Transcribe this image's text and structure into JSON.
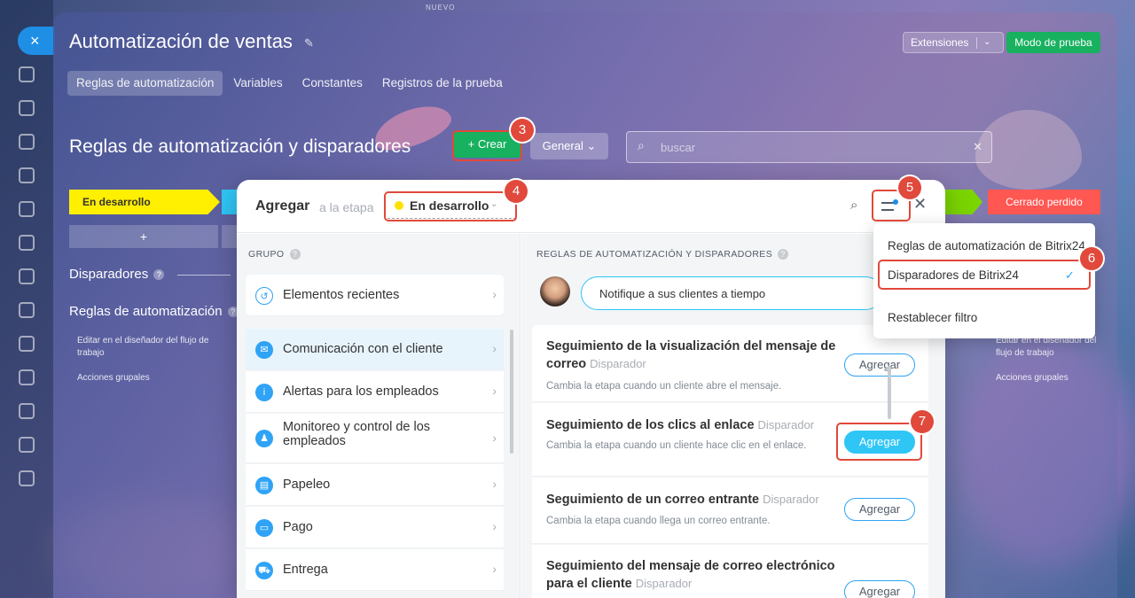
{
  "top_label": "NUEVO",
  "rail": {
    "close_icon": "×"
  },
  "header": {
    "title": "Automatización de ventas",
    "extensions_label": "Extensiones",
    "test_mode_label": "Modo de prueba",
    "tabs": [
      {
        "label": "Reglas de automatización"
      },
      {
        "label": "Variables"
      },
      {
        "label": "Constantes"
      },
      {
        "label": "Registros de la prueba"
      }
    ]
  },
  "toolbar": {
    "heading": "Reglas de automatización y disparadores",
    "create_label": "+ Crear",
    "general_label": "General",
    "search_placeholder": "buscar"
  },
  "stages": {
    "first": "En desarrollo",
    "last": "Cerrado perdido",
    "add_symbol": "+"
  },
  "sections": {
    "triggers": "Disparadores",
    "rules": "Reglas de automatización",
    "edit_link": "Editar en el diseñador del flujo de trabajo",
    "group_actions": "Acciones grupales"
  },
  "popup": {
    "title": "Agregar",
    "subtitle": "a la etapa",
    "stage": "En desarrollo",
    "group_header": "GRUPO",
    "rules_header": "REGLAS DE AUTOMATIZACIÓN Y DISPARADORES",
    "hint": "Notifique a sus clientes a tiempo",
    "groups": [
      {
        "label": "Elementos recientes"
      },
      {
        "label": "Comunicación con el cliente"
      },
      {
        "label": "Alertas para los empleados"
      },
      {
        "label": "Monitoreo y control de los empleados"
      },
      {
        "label": "Papeleo"
      },
      {
        "label": "Pago"
      },
      {
        "label": "Entrega"
      }
    ],
    "cards": [
      {
        "title": "Seguimiento de la visualización del mensaje de correo",
        "tag": "Disparador",
        "desc": "Cambia la etapa cuando un cliente abre el mensaje.",
        "button": "Agregar"
      },
      {
        "title": "Seguimiento de los clics al enlace",
        "tag": "Disparador",
        "desc": "Cambia la etapa cuando un cliente hace clic en el enlace.",
        "button": "Agregar"
      },
      {
        "title": "Seguimiento de un correo entrante",
        "tag": "Disparador",
        "desc": "Cambia la etapa cuando llega un correo entrante.",
        "button": "Agregar"
      },
      {
        "title": "Seguimiento del mensaje de correo electrónico para el cliente",
        "tag": "Disparador",
        "desc": "",
        "button": "Agregar"
      }
    ]
  },
  "filter_menu": {
    "items": [
      {
        "label": "Reglas de automatización de Bitrix24"
      },
      {
        "label": "Disparadores de Bitrix24",
        "checked": true
      },
      {
        "label": "Restablecer filtro"
      }
    ]
  },
  "callouts": [
    "3",
    "4",
    "5",
    "6",
    "7"
  ],
  "colors": {
    "accent": "#2fc6f6",
    "create": "#17b15f",
    "stage_yellow": "#ffef00",
    "stage_red": "#ff5752",
    "callout": "#e0493b"
  }
}
